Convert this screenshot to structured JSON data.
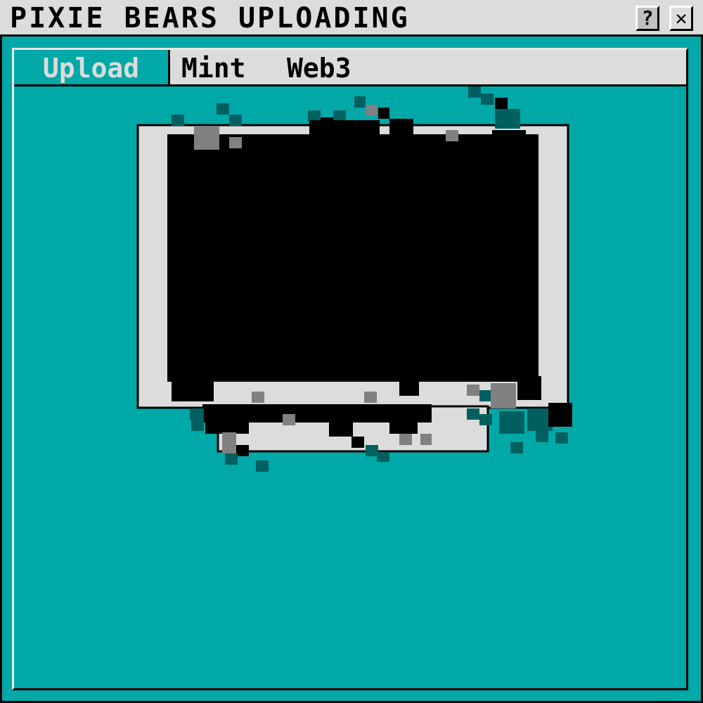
{
  "titlebar": {
    "title": "PIXIE BEARS UPLOADING",
    "help_label": "?",
    "close_label": "✕"
  },
  "tabs": [
    {
      "label": "Upload",
      "active": true
    },
    {
      "label": "Mint",
      "active": false
    },
    {
      "label": "Web3",
      "active": false
    }
  ],
  "colors": {
    "background": "#00a8a8",
    "panel": "#dcdcdc",
    "ink": "#000000",
    "glitch_gray": "#808080",
    "glitch_teal": "#006060"
  },
  "icons": [
    "help-icon",
    "close-icon"
  ]
}
